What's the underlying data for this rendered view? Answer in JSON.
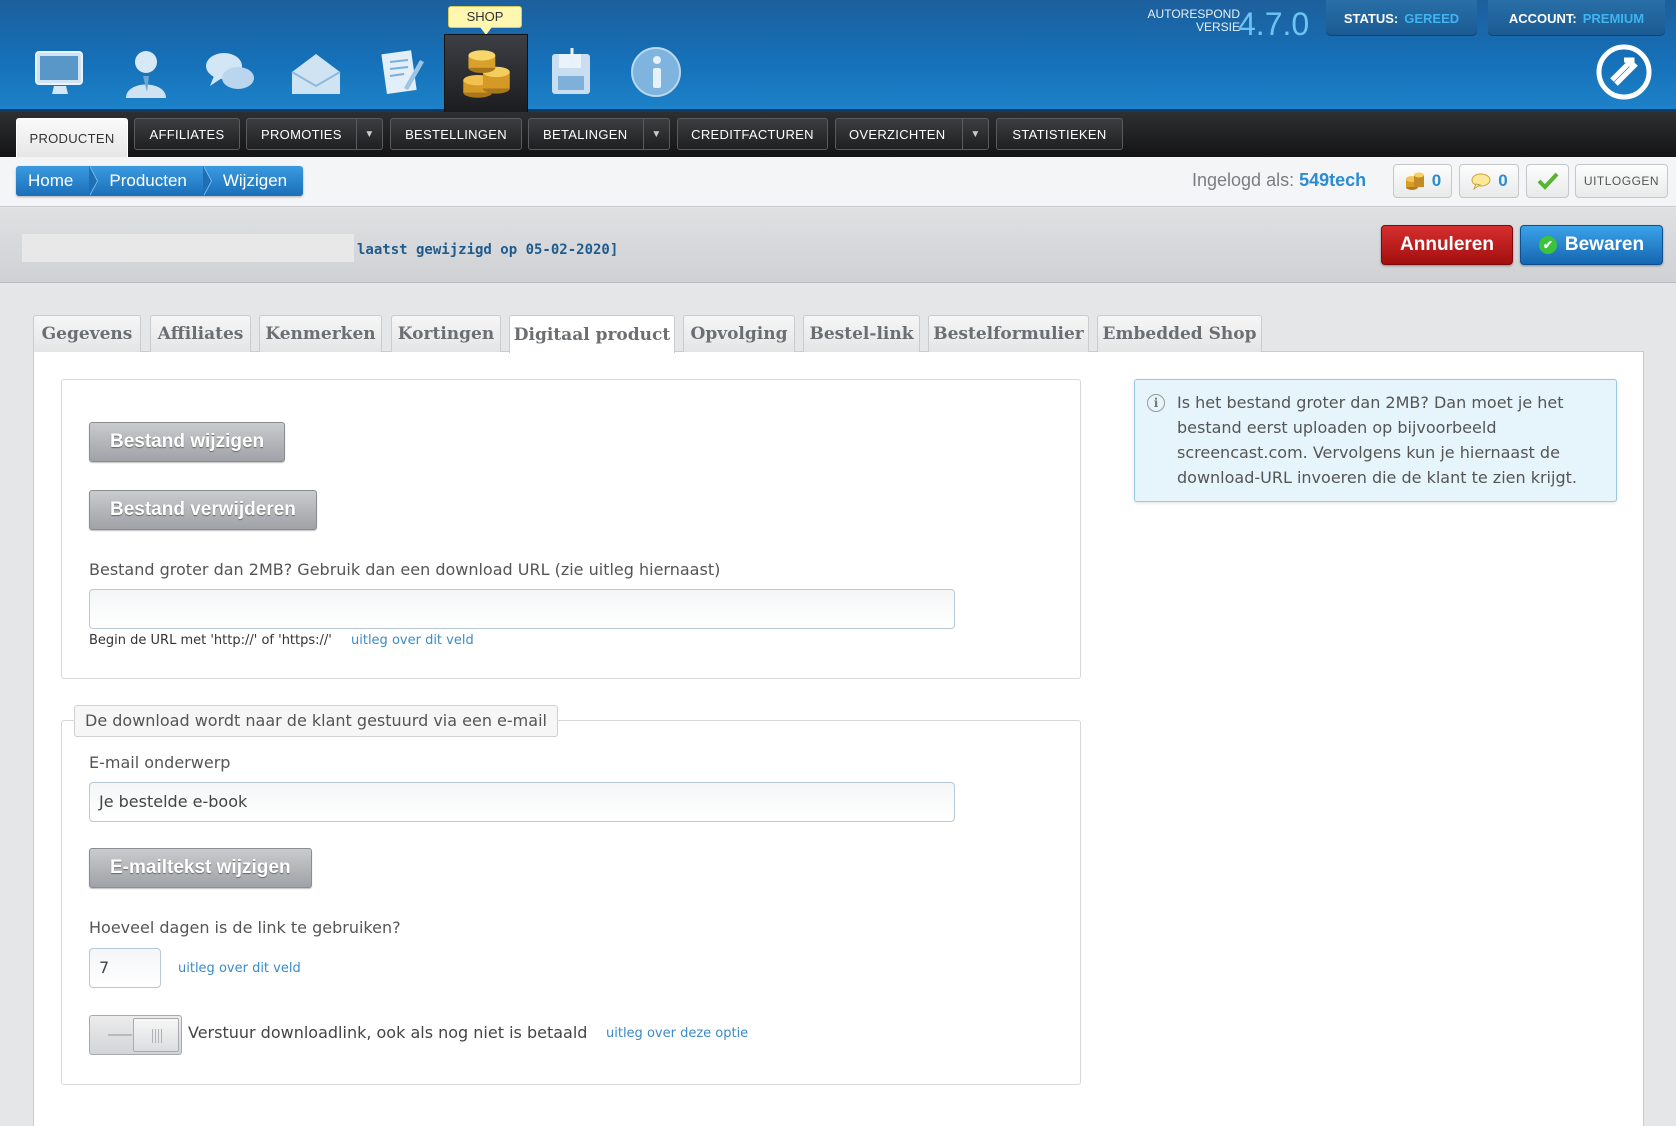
{
  "topbar": {
    "shop_label": "SHOP",
    "version_label_line1": "AUTORESPOND",
    "version_label_line2": "VERSIE",
    "version_number": "4.7.0",
    "status_label": "STATUS:",
    "status_value": "GEREED",
    "account_label": "ACCOUNT:",
    "account_value": "PREMIUM",
    "icons": [
      "monitor-icon",
      "user-icon",
      "chat-icon",
      "envelope-icon",
      "document-edit-icon",
      "coins-icon",
      "save-disk-icon",
      "info-icon"
    ]
  },
  "nav": {
    "items": [
      {
        "label": "PRODUCTEN",
        "active": true
      },
      {
        "label": "AFFILIATES"
      },
      {
        "label": "PROMOTIES",
        "dropdown": true
      },
      {
        "label": "BESTELLINGEN"
      },
      {
        "label": "BETALINGEN",
        "dropdown": true
      },
      {
        "label": "CREDITFACTUREN"
      },
      {
        "label": "OVERZICHTEN",
        "dropdown": true
      },
      {
        "label": "STATISTIEKEN"
      }
    ]
  },
  "breadcrumb": [
    "Home",
    "Producten",
    "Wijzigen"
  ],
  "session": {
    "logged_in_label": "Ingelogd als:",
    "username": "549tech",
    "coins_count": "0",
    "messages_count": "0",
    "logout_label": "UITLOGGEN"
  },
  "header": {
    "modified_text": "laatst gewijzigd op 05-02-2020]",
    "cancel_label": "Annuleren",
    "save_label": "Bewaren"
  },
  "tabs": [
    {
      "label": "Gegevens"
    },
    {
      "label": "Affiliates"
    },
    {
      "label": "Kenmerken"
    },
    {
      "label": "Kortingen"
    },
    {
      "label": "Digitaal product",
      "active": true
    },
    {
      "label": "Opvolging"
    },
    {
      "label": "Bestel-link"
    },
    {
      "label": "Bestelformulier"
    },
    {
      "label": "Embedded Shop"
    }
  ],
  "file_section": {
    "change_file_label": "Bestand wijzigen",
    "delete_file_label": "Bestand verwijderen",
    "url_label": "Bestand groter dan 2MB? Gebruik dan een download URL (zie uitleg hiernaast)",
    "url_value": "",
    "url_hint": "Begin de URL met 'http://' of 'https://'",
    "url_help_link": "uitleg over dit veld"
  },
  "email_section": {
    "legend": "De download wordt naar de klant gestuurd via een e-mail",
    "subject_label": "E-mail onderwerp",
    "subject_value": "Je bestelde e-book",
    "edit_email_label": "E-mailtekst wijzigen",
    "days_label": "Hoeveel dagen is de link te gebruiken?",
    "days_value": "7",
    "days_help_link": "uitleg over dit veld",
    "send_unpaid_label": "Verstuur downloadlink, ook als nog niet is betaald",
    "send_unpaid_enabled": false,
    "send_unpaid_help_link": "uitleg over deze optie"
  },
  "info_box": {
    "text": "Is het bestand groter dan 2MB? Dan moet je het bestand eerst uploaden op bijvoorbeeld screencast.com. Vervolgens kun je hiernaast de download-URL invoeren die de klant te zien krijgt."
  },
  "colors": {
    "brand_blue": "#1570b8",
    "accent_blue": "#2c8bd1",
    "cancel_red": "#c21d1d",
    "save_blue": "#2a86d2"
  }
}
